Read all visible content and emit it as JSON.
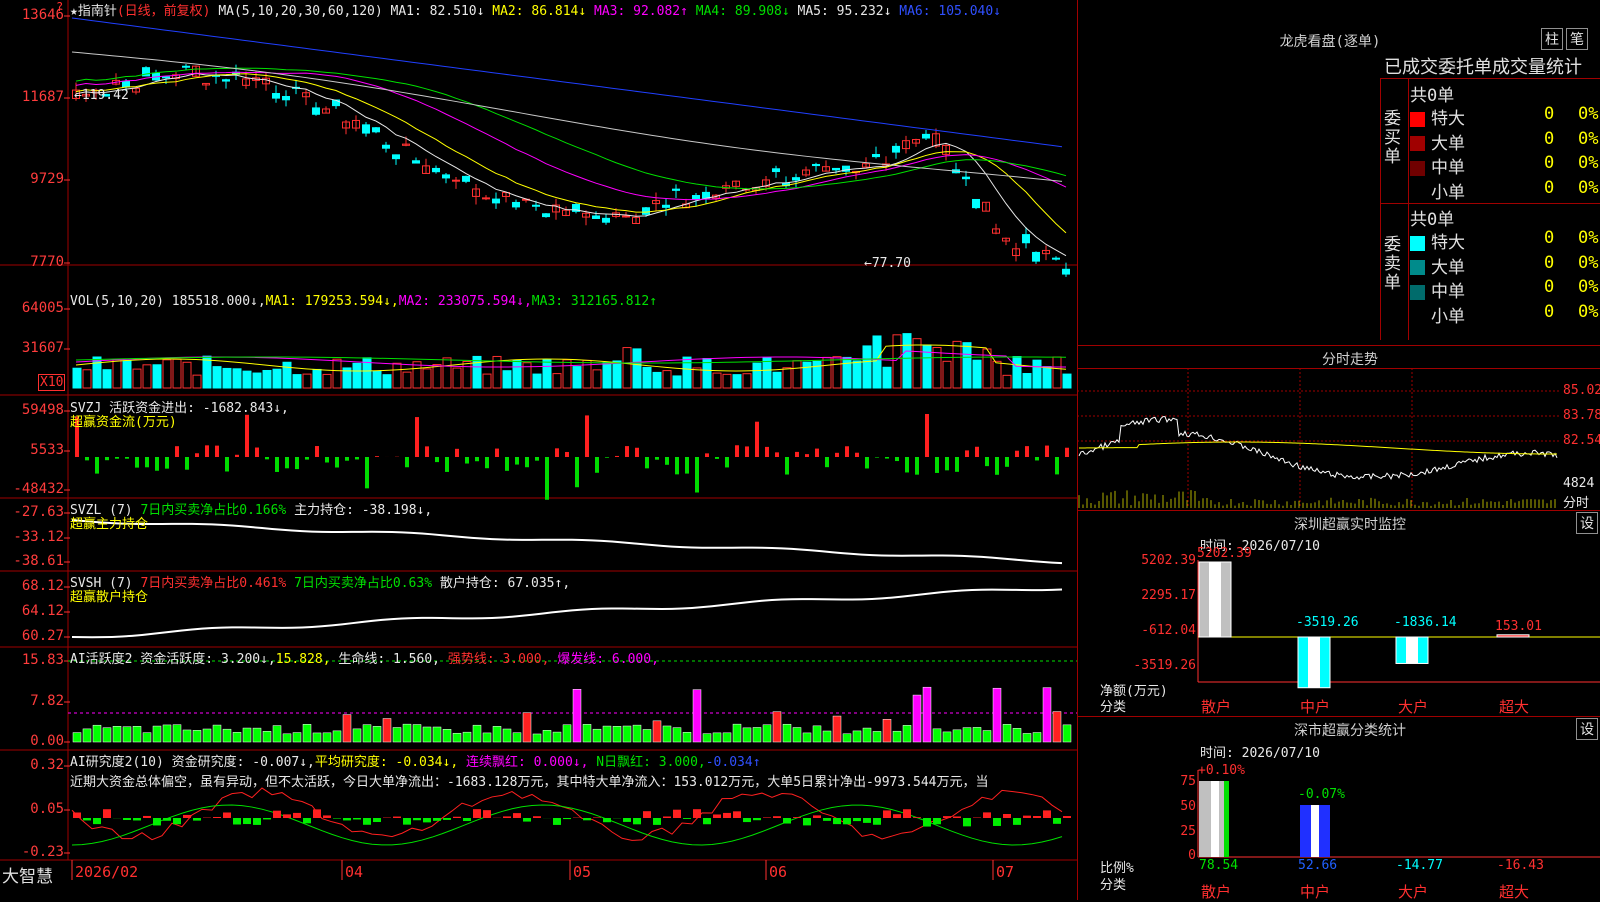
{
  "main": {
    "title": "★指南针",
    "mode": "(日线，前复权)",
    "ma_header": "MA(5,10,20,30,60,120)",
    "ma": [
      {
        "label": "MA1: 82.510",
        "arrow": "↓",
        "color": "#e8e8e8"
      },
      {
        "label": "MA2: 86.814",
        "arrow": "↓",
        "color": "#ffff00"
      },
      {
        "label": "MA3: 92.082",
        "arrow": "↑",
        "color": "#ff00ff"
      },
      {
        "label": "MA4: 89.908",
        "arrow": "↓",
        "color": "#00e000"
      },
      {
        "label": "MA5: 95.232",
        "arrow": "↓",
        "color": "#e8e8e8"
      },
      {
        "label": "MA6: 105.040",
        "arrow": "↓",
        "color": "#3050ff"
      }
    ],
    "y_labels": [
      "13646",
      "11687",
      "9729",
      "7770"
    ],
    "high_mark": "119.42",
    "low_mark": "77.70"
  },
  "vol": {
    "header": "VOL(5,10,20)",
    "value": "185518.000↓,",
    "ma1": "MA1: 179253.594↓,",
    "ma2": "MA2: 233075.594↓,",
    "ma3": "MA3: 312165.812↑",
    "y_labels": [
      "64005",
      "31607"
    ],
    "unit": "X10"
  },
  "svzj": {
    "header": "SVZJ  活跃资金进出: -1682.843↓,",
    "subtitle": "超赢资金流(万元)",
    "y_labels": [
      "59498",
      "5533",
      "-48432"
    ]
  },
  "svzl": {
    "header_a": "SVZL (7)",
    "header_b": "7日内买卖净占比0.166%",
    "header_c": "主力持仓: -38.198↓,",
    "subtitle": "超赢主力持仓",
    "y_labels": [
      "-27.63",
      "-33.12",
      "-38.61"
    ]
  },
  "svsh": {
    "header_a": "SVSH (7)",
    "header_b": "7日内买卖净占比0.461%",
    "header_c": "7日内买卖净占比0.63%",
    "header_d": "散户持仓: 67.035↑,",
    "subtitle": "超赢散户持仓",
    "y_labels": [
      "68.12",
      "64.12",
      "60.27"
    ]
  },
  "ai1": {
    "header_a": "AI活跃度2 资金活跃度: 3.200↓,",
    "header_b": "15.828,",
    "header_c": "生命线: 1.560,",
    "header_d": "强势线: 3.000,",
    "header_e": "爆发线: 6.000,",
    "y_labels": [
      "15.83",
      "7.82",
      "0.00"
    ]
  },
  "ai2": {
    "header_a": "AI研究度2(10) 资金研究度: -0.007↓,",
    "header_b": "平均研究度: -0.034↓,",
    "header_c": "连续飘红: 0.000↓,",
    "header_d": "N日飘红: 3.000,",
    "header_e": "-0.034↑",
    "comment": "近期大资金总体偏空，虽有异动，但不太活跃，今日大单净流出：-1683.128万元，其中特大单净流入：153.012万元，大单5日累计净出-9973.544万元，当",
    "y_labels": [
      "0.32",
      "0.05",
      "-0.23"
    ]
  },
  "xaxis": {
    "brand": "大智慧",
    "labels": [
      "2026/02",
      "04",
      "05",
      "06",
      "07"
    ]
  },
  "right": {
    "lhkp": {
      "title": "龙虎看盘(逐单)",
      "btn1": "柱",
      "btn2": "笔",
      "heading": "已成交委托单成交量统计"
    },
    "buy": {
      "side": "委买单",
      "total": "共0单",
      "rows": [
        {
          "label": "特大",
          "vol": "0",
          "pct": "0%",
          "color": "#ff0000"
        },
        {
          "label": "大单",
          "vol": "0",
          "pct": "0%",
          "color": "#a00000"
        },
        {
          "label": "中单",
          "vol": "0",
          "pct": "0%",
          "color": "#700000"
        },
        {
          "label": "小单",
          "vol": "0",
          "pct": "0%",
          "color": "#000000"
        }
      ]
    },
    "sell": {
      "side": "委卖单",
      "total": "共0单",
      "rows": [
        {
          "label": "特大",
          "vol": "0",
          "pct": "0%",
          "color": "#00ffff"
        },
        {
          "label": "大单",
          "vol": "0",
          "pct": "0%",
          "color": "#008b8b"
        },
        {
          "label": "中单",
          "vol": "0",
          "pct": "0%",
          "color": "#006b6b"
        },
        {
          "label": "小单",
          "vol": "0",
          "pct": "0%",
          "color": "#000000"
        }
      ]
    },
    "fenshi": {
      "title": "分时走势",
      "y_labels": [
        "85.02",
        "83.78",
        "82.54"
      ],
      "vol_label": "4824",
      "vol_unit": "分时"
    },
    "monitor": {
      "title": "深圳超赢实时监控",
      "btn": "设",
      "date": "时间: 2026/07/10",
      "y_labels": [
        "5202.39",
        "2295.17",
        "-612.04",
        "-3519.26"
      ],
      "values": [
        {
          "cat": "散户",
          "value": "5202.39",
          "num": 5202.39
        },
        {
          "cat": "中户",
          "value": "-3519.26",
          "num": -3519.26
        },
        {
          "cat": "大户",
          "value": "-1836.14",
          "num": -1836.14
        },
        {
          "cat": "超大",
          "value": "153.01",
          "num": 153.01
        }
      ],
      "unit": "净额(万元)",
      "group": "分类"
    },
    "classify": {
      "title": "深市超赢分类统计",
      "btn": "设",
      "date": "时间: 2026/07/10",
      "y_labels": [
        "75",
        "50",
        "25",
        "0"
      ],
      "top": [
        "+0.10%",
        "-0.07%"
      ],
      "bottom": [
        "78.54",
        "52.66",
        "-14.77",
        "-16.43"
      ],
      "cats": [
        "散户",
        "中户",
        "大户",
        "超大"
      ],
      "unit": "比例%",
      "group": "分类"
    }
  }
}
